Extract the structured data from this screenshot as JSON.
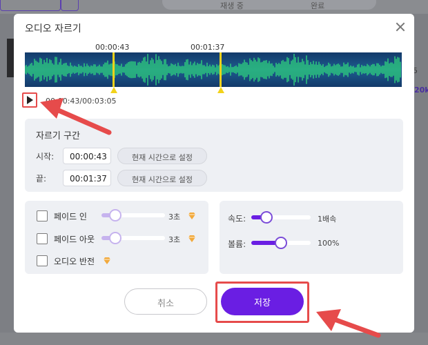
{
  "background": {
    "pill_left": "재생 중",
    "pill_right": "완료",
    "side_number": "5",
    "side_badge": "20k"
  },
  "dialog": {
    "title": "오디오 자르기",
    "start_marker": "00:00:43",
    "end_marker": "00:01:37",
    "time_readout": "00:00:43/00:03:05"
  },
  "trim": {
    "heading": "자르기 구간",
    "start_label": "시작:",
    "start_value": "00:00:43",
    "end_label": "끝:",
    "end_value": "00:01:37",
    "set_current_label": "현재 시간으로 설정"
  },
  "effects": {
    "fade_in": {
      "label": "페이드 인",
      "value": "3초",
      "level": 0.22,
      "checked": false
    },
    "fade_out": {
      "label": "페이드 아웃",
      "value": "3초",
      "level": 0.22,
      "checked": false
    },
    "reverse": {
      "label": "오디오 반전",
      "checked": false
    }
  },
  "playback": {
    "speed": {
      "label": "속도:",
      "value": "1배속",
      "level": 0.25
    },
    "volume": {
      "label": "볼륨:",
      "value": "100%",
      "level": 0.5
    }
  },
  "buttons": {
    "cancel": "취소",
    "save": "저장"
  },
  "colors": {
    "accent": "#6a1ee3",
    "marker": "#f2d21a",
    "highlight": "#e64b4b",
    "wave": "#2fd27d"
  }
}
